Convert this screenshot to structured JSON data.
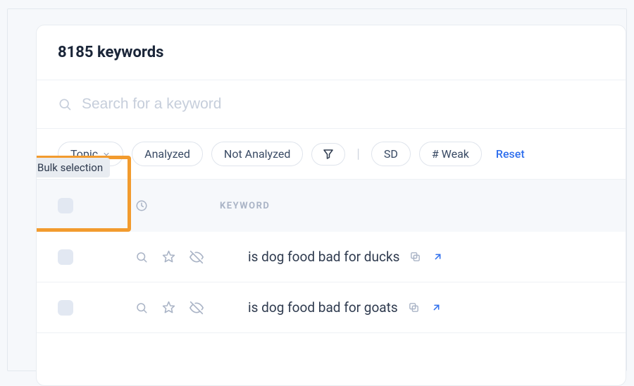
{
  "header": {
    "title": "8185 keywords"
  },
  "search": {
    "placeholder": "Search for a keyword"
  },
  "filters": {
    "topic": "Topic",
    "analyzed": "Analyzed",
    "not_analyzed": "Not Analyzed",
    "sd": "SD",
    "weak": "# Weak",
    "reset": "Reset"
  },
  "table": {
    "header": {
      "keyword": "KEYWORD"
    },
    "bulk_tooltip": "Bulk selection",
    "rows": [
      {
        "keyword": "is dog food bad for ducks"
      },
      {
        "keyword": "is dog food bad for goats"
      }
    ]
  }
}
